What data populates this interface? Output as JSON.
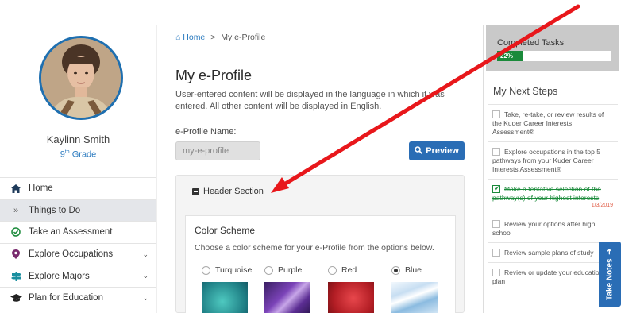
{
  "profile": {
    "name": "Kaylinn Smith",
    "grade_num": "9",
    "grade_sup": "th",
    "grade_word": "Grade"
  },
  "nav": [
    {
      "label": "Home",
      "icon": "home-icon",
      "glyph": "🏠",
      "chevron": false
    },
    {
      "label": "Things to Do",
      "icon": "double-chevron-icon",
      "glyph": "»",
      "chevron": false
    },
    {
      "label": "Take an Assessment",
      "icon": "check-circle-icon",
      "glyph": "✓",
      "chevron": false
    },
    {
      "label": "Explore Occupations",
      "icon": "map-marker-icon",
      "glyph": "●",
      "chevron": true
    },
    {
      "label": "Explore Majors",
      "icon": "signpost-icon",
      "glyph": "✚",
      "chevron": true
    },
    {
      "label": "Plan for Education",
      "icon": "graduation-cap-icon",
      "glyph": "🎓",
      "chevron": true
    }
  ],
  "breadcrumb": {
    "home": "Home",
    "sep": ">",
    "current": "My e-Profile"
  },
  "main": {
    "title": "My e-Profile",
    "intro": "User-entered content will be displayed in the language in which it was entered. All other content will be displayed in English.",
    "name_label": "e-Profile Name:",
    "name_value": "my-e-profile",
    "preview_label": "Preview"
  },
  "header_section": {
    "title": "Header Section",
    "color_scheme_title": "Color Scheme",
    "color_scheme_desc": "Choose a color scheme for your e-Profile from the options below.",
    "options": [
      {
        "label": "Turquoise",
        "selected": false,
        "color": "#2a9d9a"
      },
      {
        "label": "Purple",
        "selected": false,
        "color": "#7a3fa8"
      },
      {
        "label": "Red",
        "selected": false,
        "color": "#c4242b"
      },
      {
        "label": "Blue",
        "selected": true,
        "color": "#9cc4e4"
      }
    ]
  },
  "right": {
    "completed_title": "Completed Tasks",
    "completed_percent": 22,
    "completed_label": "22%",
    "next_steps_title": "My Next Steps",
    "steps": [
      {
        "text": "Take, re-take, or review results of the Kuder Career Interests Assessment®",
        "done": false,
        "date": ""
      },
      {
        "text": "Explore occupations in the top 5 pathways from your Kuder Career Interests Assessment®",
        "done": false,
        "date": ""
      },
      {
        "text": "Make a tentative selection of the pathway(s) of your highest interests",
        "done": true,
        "date": "1/3/2019"
      },
      {
        "text": "Review your options after high school",
        "done": false,
        "date": ""
      },
      {
        "text": "Review sample plans of study",
        "done": false,
        "date": ""
      },
      {
        "text": "Review or update your education plan",
        "done": false,
        "date": ""
      }
    ],
    "take_notes": "Take Notes"
  },
  "colors": {
    "accent": "#2a6db5",
    "success": "#1a8a3a",
    "arrow": "#e8171b"
  }
}
